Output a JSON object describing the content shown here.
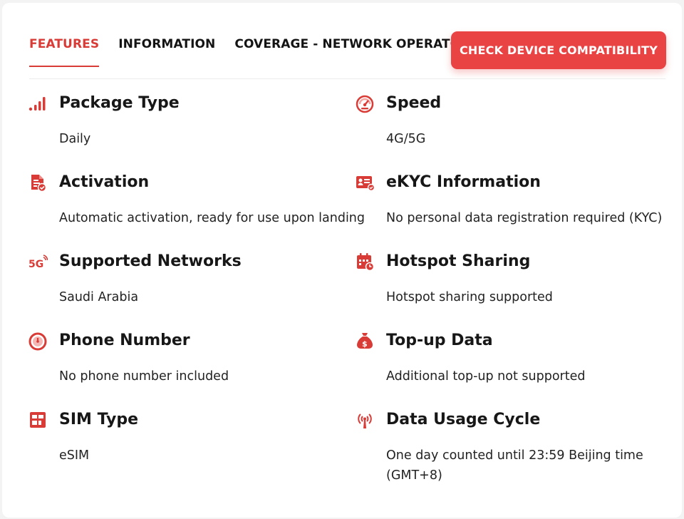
{
  "tabs": [
    {
      "label": "FEATURES",
      "active": true
    },
    {
      "label": "INFORMATION",
      "active": false
    },
    {
      "label": "COVERAGE - NETWORK OPERATORS",
      "active": false
    }
  ],
  "cta": {
    "label": "CHECK DEVICE COMPATIBILITY"
  },
  "colors": {
    "accent": "#d93b36",
    "button": "#ea4343",
    "text": "#171717"
  },
  "features": {
    "package_type": {
      "icon": "signal-bars-icon",
      "title": "Package Type",
      "value": "Daily"
    },
    "speed": {
      "icon": "speedometer-icon",
      "title": "Speed",
      "value": "4G/5G"
    },
    "activation": {
      "icon": "document-check-icon",
      "title": "Activation",
      "value": "Automatic activation, ready for use upon landing"
    },
    "ekyc": {
      "icon": "id-card-icon",
      "title": "eKYC Information",
      "value": "No personal data registration required (KYC)"
    },
    "networks": {
      "icon": "5g-icon",
      "title": "Supported Networks",
      "value": "Saudi Arabia"
    },
    "hotspot": {
      "icon": "calendar-clock-icon",
      "title": "Hotspot Sharing",
      "value": "Hotspot sharing supported"
    },
    "phone": {
      "icon": "timer-icon",
      "title": "Phone Number",
      "value": "No phone number included"
    },
    "topup": {
      "icon": "money-bag-icon",
      "title": "Top-up Data",
      "value": "Additional top-up not supported"
    },
    "sim": {
      "icon": "sim-card-icon",
      "title": "SIM Type",
      "value": "eSIM"
    },
    "cycle": {
      "icon": "antenna-icon",
      "title": "Data Usage Cycle",
      "value": "One day counted until 23:59 Beijing time (GMT+8)"
    }
  }
}
